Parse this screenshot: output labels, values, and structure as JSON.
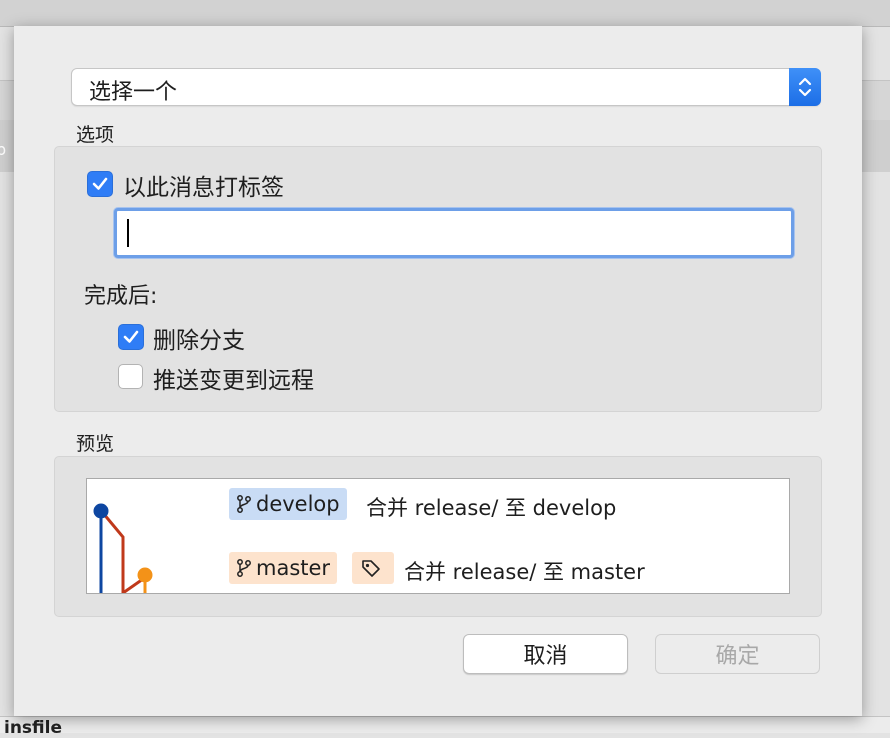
{
  "background": {
    "left_fragment_text": "p",
    "bottom_fragment_text": "insfile"
  },
  "dialog": {
    "select": {
      "value": "选择一个",
      "stepper_icon": "up-down-chevron-icon"
    },
    "options": {
      "section_label": "选项",
      "tag_checkbox": {
        "label": "以此消息打标签",
        "checked": true
      },
      "tag_message_value": "",
      "after_label": "完成后:",
      "delete_branch": {
        "label": "删除分支",
        "checked": true
      },
      "push_remote": {
        "label": "推送变更到远程",
        "checked": false
      }
    },
    "preview": {
      "section_label": "预览",
      "commits": [
        {
          "branch": "develop",
          "branch_icon": "branch-icon",
          "message": "合并 release/ 至 develop",
          "color": "#0d46a1"
        },
        {
          "branch": "master",
          "branch_icon": "branch-icon",
          "tag_icon": "tag-icon",
          "message": "合并 release/ 至 master",
          "color": "#f39218"
        }
      ],
      "line_colors": {
        "develop": "#0d46a1",
        "release": "#c0391b",
        "master": "#f39218"
      }
    },
    "buttons": {
      "cancel": "取消",
      "ok": "确定"
    },
    "accent": "#2f7df6"
  }
}
